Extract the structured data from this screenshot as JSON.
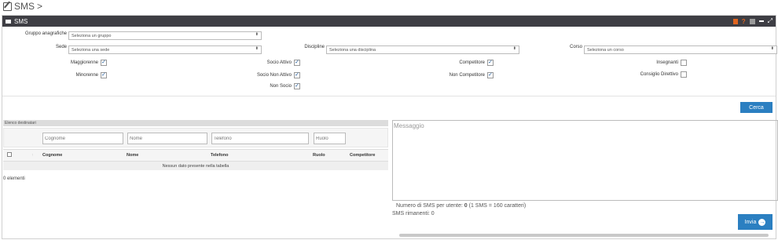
{
  "breadcrumb": {
    "icon": "edit-icon",
    "title": "SMS",
    "separator": ">"
  },
  "portlet": {
    "title": "SMS",
    "help": "?"
  },
  "filters": {
    "gruppo": {
      "label": "Gruppo anagrafiche",
      "value": "Seleziona un gruppo"
    },
    "sede": {
      "label": "Sede",
      "value": "Seleziona una sede"
    },
    "discipline": {
      "label": "Discipline",
      "value": "Seleziona una disciplina"
    },
    "corso": {
      "label": "Corso",
      "value": "Seleziona un corso"
    },
    "arrows": "⬍"
  },
  "checkboxes": [
    {
      "label": "Maggiorenne",
      "checked": true
    },
    {
      "label": "Minorenne",
      "checked": true
    },
    {
      "label": "Socio Attivo",
      "checked": true
    },
    {
      "label": "Socio Non Attivo",
      "checked": true
    },
    {
      "label": "Non Socio",
      "checked": true
    },
    {
      "label": "Competitore",
      "checked": true
    },
    {
      "label": "Non Competitore",
      "checked": true
    },
    {
      "label": "Insegnanti",
      "checked": false
    },
    {
      "label": "Consiglio Direttivo",
      "checked": false
    }
  ],
  "search_button": "Cerca",
  "table": {
    "title": "Elenco destinatari",
    "filter_placeholders": {
      "cognome": "Cognome",
      "nome": "Nome",
      "telefono": "Telefono",
      "ruolo": "Ruolo"
    },
    "columns": [
      "Cognome",
      "Nome",
      "Telefono",
      "Ruolo",
      "Competitore"
    ],
    "sort_glyph": "↑",
    "empty": "Nessun dato presente nella tabella",
    "count": "0 elementi"
  },
  "message": {
    "placeholder": "Messaggio",
    "per_user_prefix": "Numero di SMS per utente: ",
    "per_user_value": "0",
    "per_user_suffix": " (1 SMS = 160 caratteri)",
    "remaining_label": "SMS rimanenti: ",
    "remaining_value": "0"
  },
  "send_button": "Invia",
  "colors": {
    "primary": "#2b7fc1",
    "header": "#3e3e44",
    "accent": "#e0641f",
    "check": "#1f5b9c"
  }
}
